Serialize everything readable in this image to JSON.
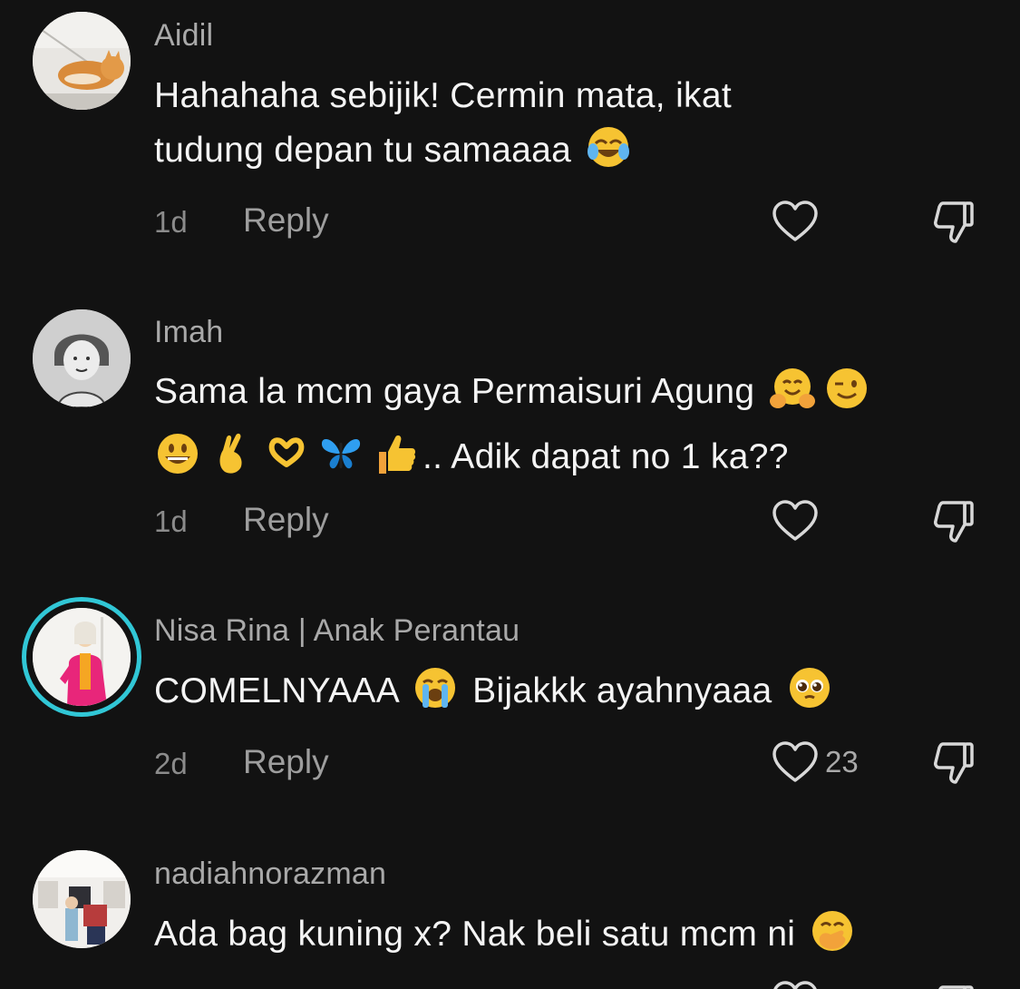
{
  "comments": [
    {
      "username": "Aidil",
      "text_line1": "Hahahaha sebijik! Cermin mata, ikat",
      "text_line2": "tudung depan tu samaaaa",
      "emojis": [
        "face-with-tears-of-joy"
      ],
      "time": "1d",
      "reply_label": "Reply",
      "like_count": "",
      "avatar": "cat-photo"
    },
    {
      "username": "Imah",
      "text_line1": "Sama la mcm gaya Permaisuri Agung",
      "text_line2_suffix": ".. Adik dapat no 1 ka??",
      "emojis": [
        "hugging-face",
        "winking-face",
        "grinning-face",
        "crossed-fingers",
        "heart-hands",
        "butterfly",
        "thumbs-up"
      ],
      "time": "1d",
      "reply_label": "Reply",
      "like_count": "",
      "avatar": "sketch-portrait"
    },
    {
      "username": "Nisa Rina | Anak Perantau",
      "text_part1": "COMELNYAAA",
      "text_part2": "Bijakkk ayahnyaaa",
      "emojis": [
        "loudly-crying-face",
        "pleading-face"
      ],
      "time": "2d",
      "reply_label": "Reply",
      "like_count": "23",
      "avatar": "woman-pink-sweater",
      "story_ring_color": "#31c7d6"
    },
    {
      "username": "nadiahnorazman",
      "text_line1": "Ada bag kuning x? Nak beli satu mcm ni",
      "emojis": [
        "face-with-hand-over-mouth"
      ],
      "avatar": "store-photo"
    }
  ],
  "colors": {
    "background": "#121212",
    "username": "#a9a9a9",
    "text": "#f4f4f4",
    "meta": "#8b8b8b",
    "story_ring": "#31c7d6"
  }
}
